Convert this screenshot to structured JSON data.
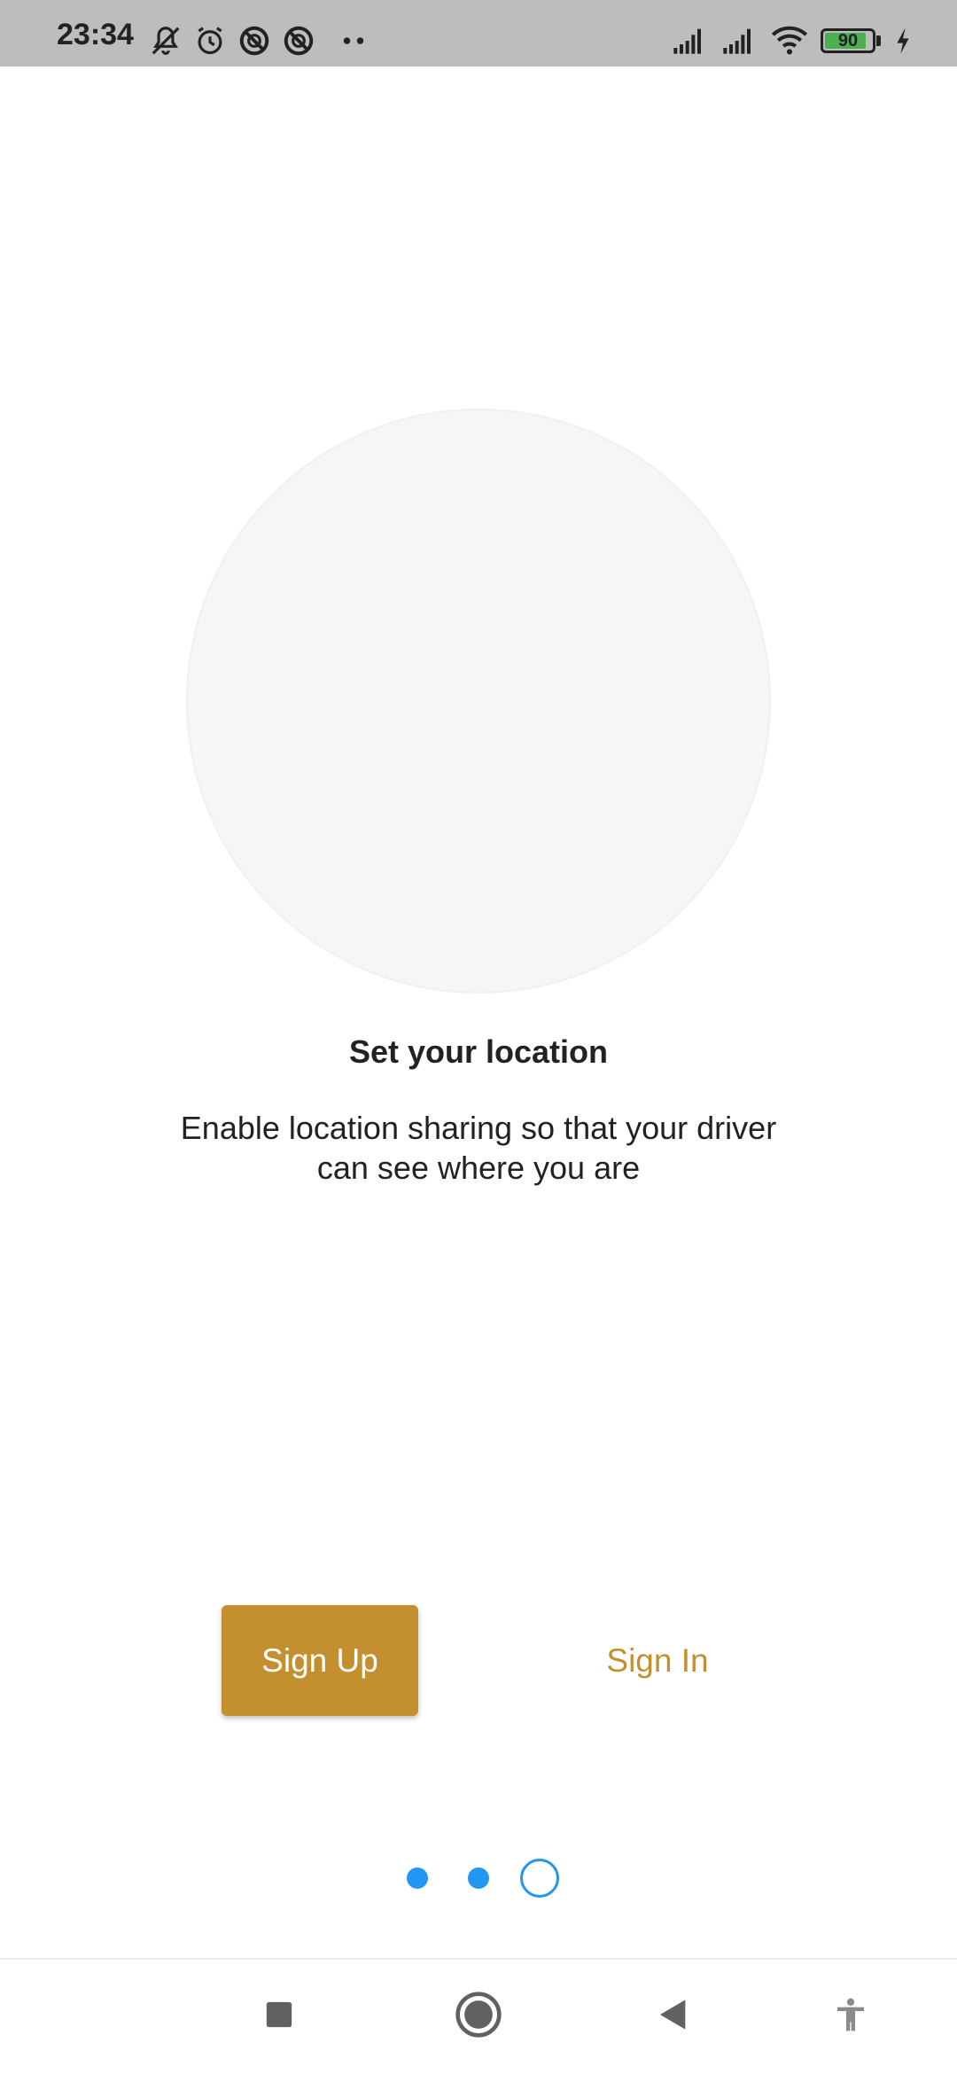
{
  "status_bar": {
    "time": "23:34",
    "left_icons": [
      "bell-off-icon",
      "alarm-icon",
      "blocked-app-icon",
      "blocked-app-icon",
      "more-dots-icon"
    ],
    "right_icons": [
      "signal-icon",
      "signal-icon",
      "wifi-icon",
      "battery-icon",
      "charging-icon"
    ],
    "battery_level": "90"
  },
  "onboarding": {
    "title": "Set your location",
    "description": "Enable location sharing so that your driver can see where you are"
  },
  "actions": {
    "sign_up_label": "Sign Up",
    "sign_in_label": "Sign In"
  },
  "pager": {
    "total_pages": 3,
    "current_page": 3
  },
  "nav_bar": {
    "buttons": [
      "recents-icon",
      "home-icon",
      "back-icon",
      "accessibility-icon"
    ]
  },
  "colors": {
    "accent": "#c48f2f",
    "indicator": "#2196f3",
    "status_bar_bg": "#bdbdbd",
    "battery_fill": "#4caf50"
  }
}
